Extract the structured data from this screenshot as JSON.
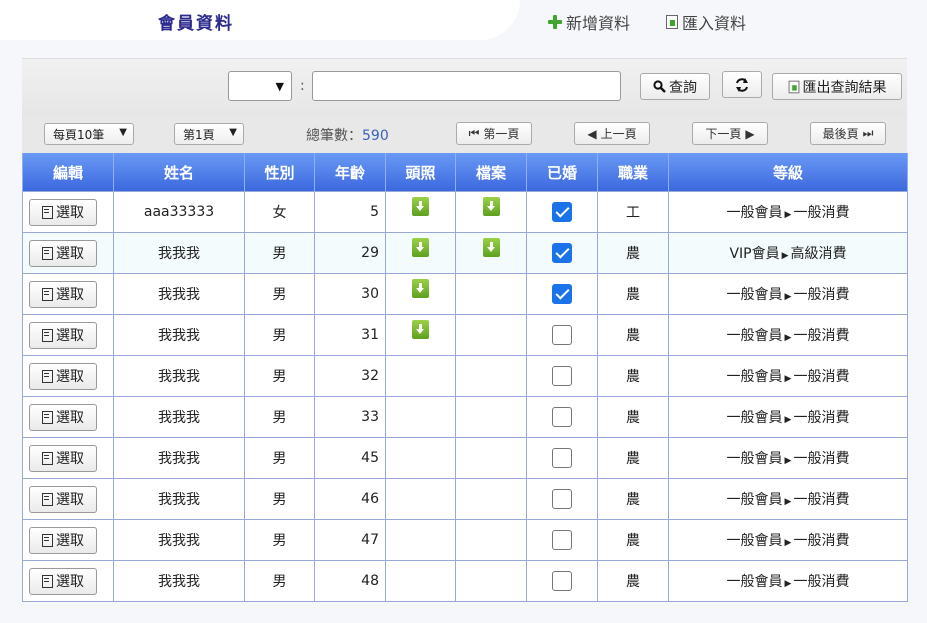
{
  "header": {
    "title": "會員資料",
    "add_label": "新增資料",
    "import_label": "匯入資料"
  },
  "search": {
    "field_value": "",
    "colon": ":",
    "query_placeholder": "",
    "query_label": "查詢",
    "export_label": "匯出查詢結果"
  },
  "pager": {
    "page_size": "每頁10筆",
    "page": "第1頁",
    "total_label": "總筆數：",
    "total": "590",
    "first": "第一頁",
    "prev": "上一頁",
    "next": "下一頁",
    "last": "最後頁"
  },
  "table": {
    "columns": [
      "編輯",
      "姓名",
      "性別",
      "年齡",
      "頭照",
      "檔案",
      "已婚",
      "職業",
      "等級"
    ],
    "select_label": "選取",
    "rows": [
      {
        "name": "aaa33333",
        "gender": "女",
        "age": "5",
        "photo": true,
        "file": true,
        "married": true,
        "job": "工",
        "level": "一般會員",
        "sub": "一般消費"
      },
      {
        "name": "我我我",
        "gender": "男",
        "age": "29",
        "photo": true,
        "file": true,
        "married": true,
        "job": "農",
        "level": "VIP會員",
        "sub": "高級消費"
      },
      {
        "name": "我我我",
        "gender": "男",
        "age": "30",
        "photo": true,
        "file": false,
        "married": true,
        "job": "農",
        "level": "一般會員",
        "sub": "一般消費"
      },
      {
        "name": "我我我",
        "gender": "男",
        "age": "31",
        "photo": true,
        "file": false,
        "married": false,
        "job": "農",
        "level": "一般會員",
        "sub": "一般消費"
      },
      {
        "name": "我我我",
        "gender": "男",
        "age": "32",
        "photo": false,
        "file": false,
        "married": false,
        "job": "農",
        "level": "一般會員",
        "sub": "一般消費"
      },
      {
        "name": "我我我",
        "gender": "男",
        "age": "33",
        "photo": false,
        "file": false,
        "married": false,
        "job": "農",
        "level": "一般會員",
        "sub": "一般消費"
      },
      {
        "name": "我我我",
        "gender": "男",
        "age": "45",
        "photo": false,
        "file": false,
        "married": false,
        "job": "農",
        "level": "一般會員",
        "sub": "一般消費"
      },
      {
        "name": "我我我",
        "gender": "男",
        "age": "46",
        "photo": false,
        "file": false,
        "married": false,
        "job": "農",
        "level": "一般會員",
        "sub": "一般消費"
      },
      {
        "name": "我我我",
        "gender": "男",
        "age": "47",
        "photo": false,
        "file": false,
        "married": false,
        "job": "農",
        "level": "一般會員",
        "sub": "一般消費"
      },
      {
        "name": "我我我",
        "gender": "男",
        "age": "48",
        "photo": false,
        "file": false,
        "married": false,
        "job": "農",
        "level": "一般會員",
        "sub": "一般消費"
      }
    ]
  }
}
